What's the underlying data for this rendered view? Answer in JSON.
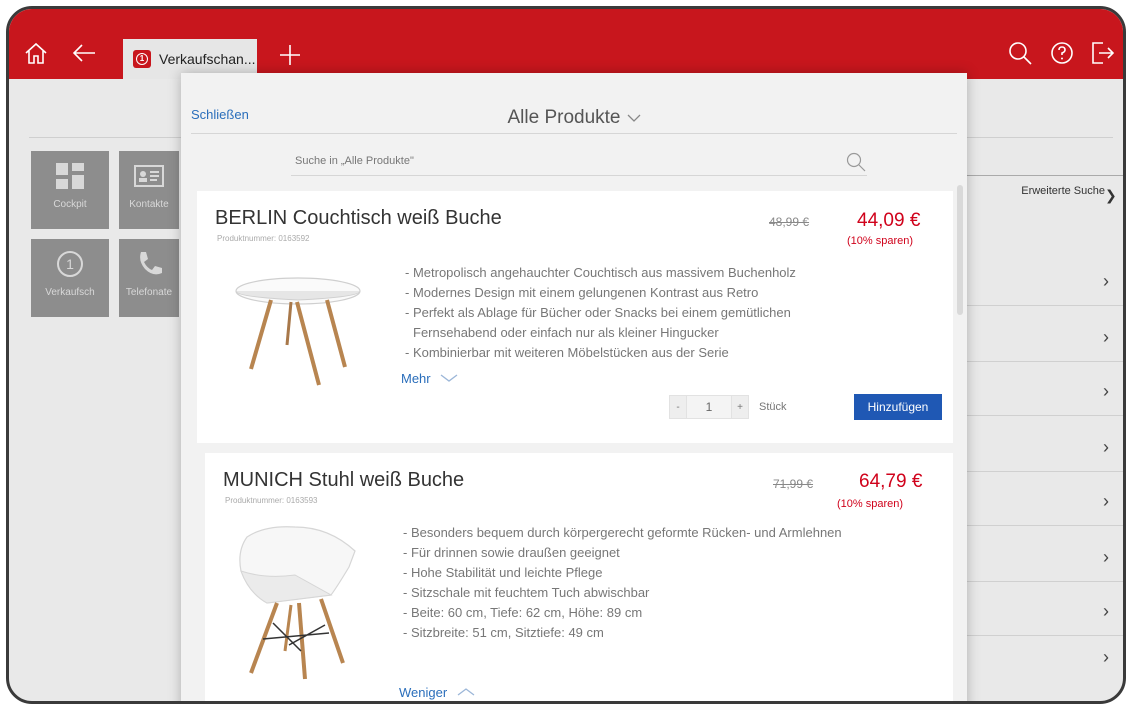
{
  "topbar": {
    "tab_label": "Verkaufschan...",
    "tab_badge": "1",
    "colors": {
      "brand": "#c8161d",
      "tab_bg": "#e6e6e6"
    }
  },
  "tiles": [
    {
      "label": "Cockpit",
      "icon": "dashboard-icon"
    },
    {
      "label": "Kontakte",
      "icon": "contact-card-icon"
    },
    {
      "label": "Verkaufsch",
      "icon": "badge-1-icon"
    },
    {
      "label": "Telefonate",
      "icon": "phone-icon"
    }
  ],
  "right_panel": {
    "advanced_search_label": "Erweiterte Suche"
  },
  "modal": {
    "close_label": "Schließen",
    "title": "Alle Produkte",
    "search_placeholder": "Suche in „Alle Produkte\""
  },
  "products": [
    {
      "name": "BERLIN Couchtisch weiß Buche",
      "number": "Produktnummer: 0163592",
      "old_price": "48,99 €",
      "new_price": "44,09 €",
      "saving": "(10% sparen)",
      "features": [
        "- Metropolisch angehauchter Couchtisch aus massivem Buchenholz",
        "- Modernes Design mit einem gelungenen Kontrast aus Retro",
        "- Perfekt als Ablage für Bücher oder Snacks bei einem gemütlichen",
        "  Fernsehabend oder einfach nur als kleiner Hingucker",
        "- Kombinierbar mit weiteren Möbelstücken aus der Serie"
      ],
      "toggle_label": "Mehr",
      "qty_minus": "-",
      "qty_value": "1",
      "qty_plus": "+",
      "unit": "Stück",
      "add_label": "Hinzufügen"
    },
    {
      "name": "MUNICH Stuhl weiß Buche",
      "number": "Produktnummer: 0163593",
      "old_price": "71,99 €",
      "new_price": "64,79 €",
      "saving": "(10% sparen)",
      "features": [
        "- Besonders bequem durch körpergerecht geformte Rücken- und Armlehnen",
        "- Für drinnen sowie draußen geeignet",
        "- Hohe Stabilität und leichte Pflege",
        "- Sitzschale mit feuchtem Tuch abwischbar",
        "- Beite: 60 cm, Tiefe: 62 cm, Höhe: 89 cm",
        "- Sitzbreite: 51 cm, Sitztiefe: 49 cm"
      ],
      "toggle_label": "Weniger"
    }
  ],
  "colors": {
    "link": "#2a6ebb",
    "price": "#d0021b",
    "button": "#1f58b4"
  }
}
